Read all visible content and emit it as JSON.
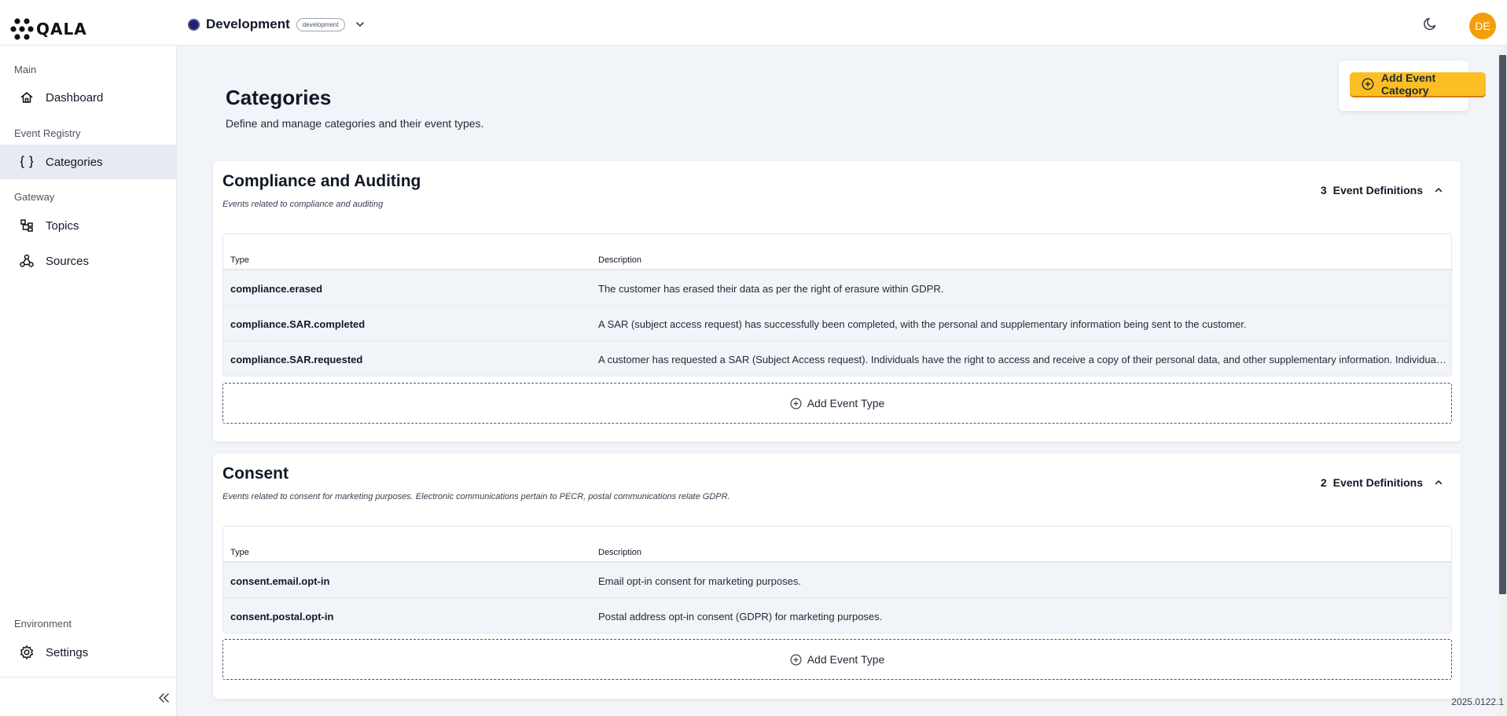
{
  "app": {
    "logo_text": "QALA"
  },
  "header": {
    "environment": {
      "name": "Development",
      "badge": "development"
    },
    "avatar_initials": "DE"
  },
  "sidebar": {
    "groups": [
      {
        "label": "Main",
        "items": [
          {
            "label": "Dashboard",
            "icon": "home-icon"
          }
        ]
      },
      {
        "label": "Event Registry",
        "items": [
          {
            "label": "Categories",
            "icon": "braces-icon",
            "active": true
          }
        ]
      },
      {
        "label": "Gateway",
        "items": [
          {
            "label": "Topics",
            "icon": "topics-icon"
          },
          {
            "label": "Sources",
            "icon": "webhook-icon"
          }
        ]
      },
      {
        "label": "Environment",
        "items": [
          {
            "label": "Settings",
            "icon": "gear-icon"
          }
        ]
      }
    ]
  },
  "page": {
    "title": "Categories",
    "subtitle": "Define and manage categories and their event types.",
    "add_category_label": "Add Event Category"
  },
  "table_headers": {
    "type": "Type",
    "description": "Description"
  },
  "add_event_type_label": "Add Event Type",
  "definitions_label": "Event Definitions",
  "categories": [
    {
      "title": "Compliance and Auditing",
      "description": "Events related to compliance and auditing",
      "count": "3",
      "rows": [
        {
          "type": "compliance.erased",
          "description": "The customer has erased their data as per the right of erasure within GDPR."
        },
        {
          "type": "compliance.SAR.completed",
          "description": "A SAR (subject access request) has successfully been completed, with the personal and supplementary information being sent to the customer."
        },
        {
          "type": "compliance.SAR.requested",
          "description": "A customer has requested a SAR (Subject Access request). Individuals have the right to access and receive a copy of their personal data, and other supplementary information. Individuals ..."
        }
      ]
    },
    {
      "title": "Consent",
      "description": "Events related to consent for marketing purposes. Electronic communications pertain to PECR, postal communications relate GDPR.",
      "count": "2",
      "rows": [
        {
          "type": "consent.email.opt-in",
          "description": "Email opt-in consent for marketing purposes."
        },
        {
          "type": "consent.postal.opt-in",
          "description": "Postal address opt-in consent (GDPR) for marketing purposes."
        }
      ]
    }
  ],
  "version": "2025.0122.1",
  "colors": {
    "accent": "#fbbf24",
    "avatar": "#f59e0b",
    "env_dot": "#1e1b8a",
    "active_nav": "#e5ebf1"
  }
}
